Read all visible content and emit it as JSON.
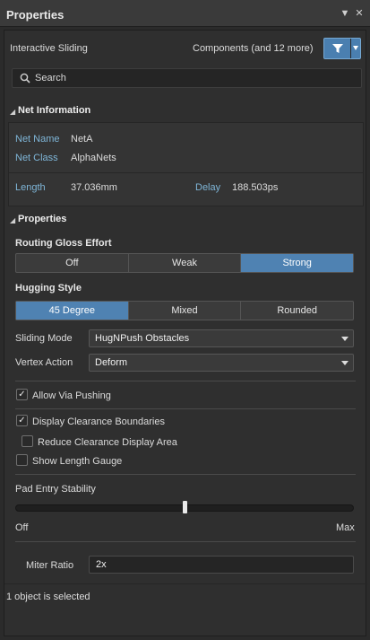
{
  "window": {
    "title": "Properties"
  },
  "toolbar": {
    "mode_label": "Interactive Sliding",
    "filter_label": "Components (and 12 more)"
  },
  "search": {
    "placeholder": "Search"
  },
  "net_info": {
    "header": "Net Information",
    "net_name_label": "Net Name",
    "net_name_value": "NetA",
    "net_class_label": "Net Class",
    "net_class_value": "AlphaNets",
    "length_label": "Length",
    "length_value": "37.036mm",
    "delay_label": "Delay",
    "delay_value": "188.503ps"
  },
  "properties": {
    "header": "Properties",
    "routing_gloss_label": "Routing Gloss Effort",
    "routing_gloss_options": [
      "Off",
      "Weak",
      "Strong"
    ],
    "routing_gloss_selected": "Strong",
    "hugging_label": "Hugging Style",
    "hugging_options": [
      "45 Degree",
      "Mixed",
      "Rounded"
    ],
    "hugging_selected": "45 Degree",
    "sliding_mode_label": "Sliding Mode",
    "sliding_mode_value": "HugNPush Obstacles",
    "vertex_action_label": "Vertex Action",
    "vertex_action_value": "Deform",
    "allow_via_pushing": {
      "label": "Allow Via Pushing",
      "checked": true
    },
    "display_clearance": {
      "label": "Display Clearance Boundaries",
      "checked": true
    },
    "reduce_clearance": {
      "label": "Reduce Clearance Display Area",
      "checked": false
    },
    "show_length_gauge": {
      "label": "Show Length Gauge",
      "checked": false
    },
    "pad_entry_label": "Pad Entry Stability",
    "pad_entry_value": 0.5,
    "slider_min_label": "Off",
    "slider_max_label": "Max",
    "miter_ratio_label": "Miter Ratio",
    "miter_ratio_value": "2x"
  },
  "status": {
    "text": "1 object is selected"
  },
  "colors": {
    "accent": "#4f82b2",
    "label_blue": "#7fb6d8",
    "background": "#2f2f2f"
  }
}
